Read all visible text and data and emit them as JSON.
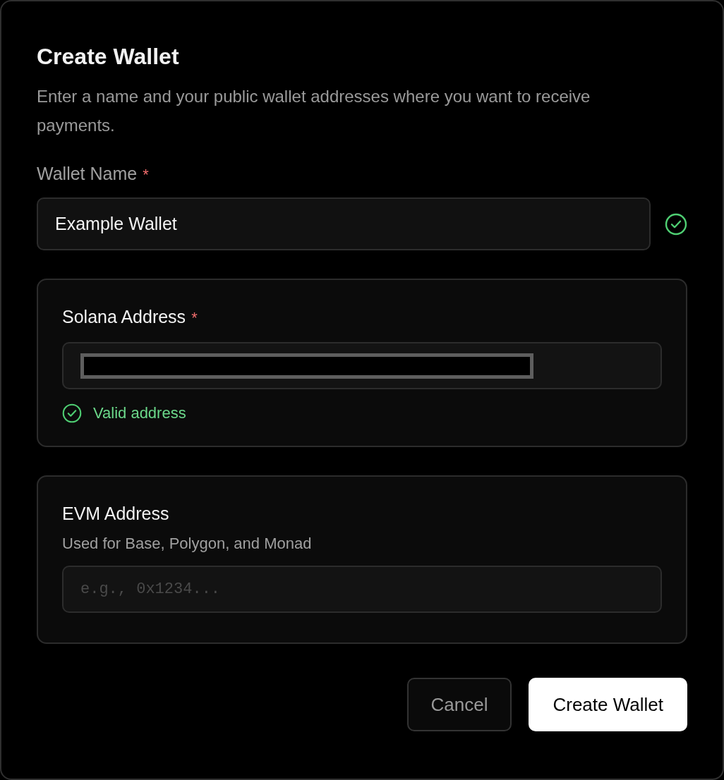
{
  "dialog": {
    "title": "Create Wallet",
    "description": "Enter a name and your public wallet addresses where you want to receive payments."
  },
  "wallet_name": {
    "label": "Wallet Name",
    "required_mark": "*",
    "value": "Example Wallet",
    "valid": true
  },
  "solana": {
    "label": "Solana Address",
    "required_mark": "*",
    "value_hidden": true,
    "validation": {
      "text": "Valid address",
      "valid": true
    }
  },
  "evm": {
    "label": "EVM Address",
    "hint": "Used for Base, Polygon, and Monad",
    "placeholder": "e.g., 0x1234..."
  },
  "buttons": [
    {
      "label": "Cancel",
      "kind": "secondary"
    },
    {
      "label": "Create Wallet",
      "kind": "primary"
    }
  ]
}
